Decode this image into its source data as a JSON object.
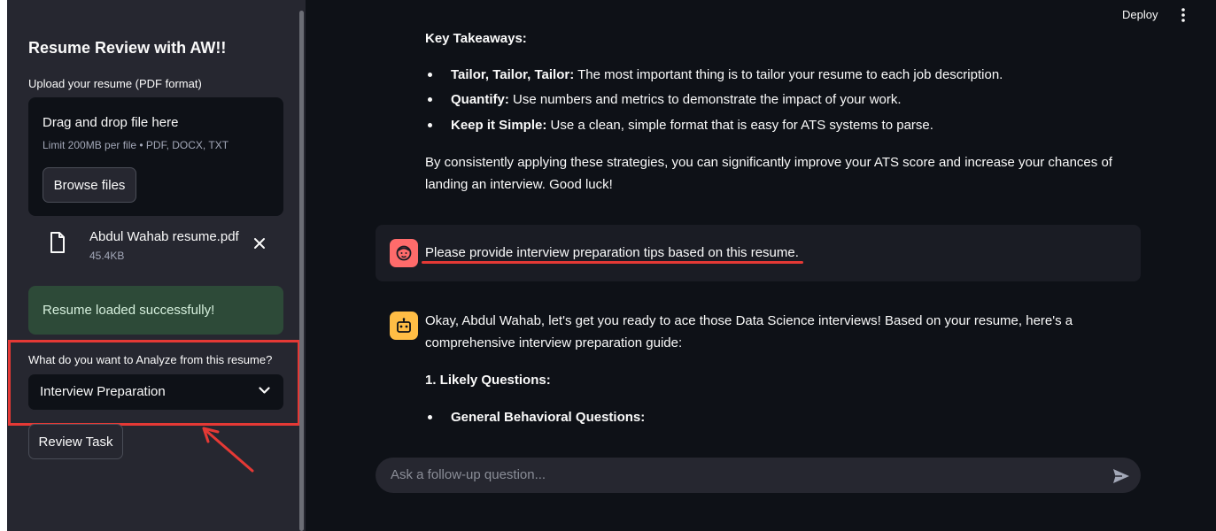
{
  "sidebar": {
    "title": "Resume Review with AW!!",
    "upload_label": "Upload your resume (PDF format)",
    "dropzone": {
      "title": "Drag and drop file here",
      "limit": "Limit 200MB per file • PDF, DOCX, TXT",
      "browse_label": "Browse files"
    },
    "file": {
      "name": "Abdul Wahab resume.pdf",
      "size": "45.4KB",
      "icon": "file-icon"
    },
    "success_message": "Resume loaded successfully!",
    "analyze_label": "What do you want to Analyze from this resume?",
    "analyze_selected": "Interview Preparation",
    "review_button": "Review Task"
  },
  "header": {
    "deploy_label": "Deploy"
  },
  "chat": {
    "prev_response": {
      "heading": "Key Takeaways:",
      "bullets": [
        {
          "bold": "Tailor, Tailor, Tailor:",
          "text": " The most important thing is to tailor your resume to each job description."
        },
        {
          "bold": "Quantify:",
          "text": " Use numbers and metrics to demonstrate the impact of your work."
        },
        {
          "bold": "Keep it Simple:",
          "text": " Use a clean, simple format that is easy for ATS systems to parse."
        }
      ],
      "closing_line1": "By consistently applying these strategies, you can significantly improve your ATS score and increase your chances of",
      "closing_line2": "landing an interview. Good luck!"
    },
    "user_message": "Please provide interview preparation tips based on this resume.",
    "assistant": {
      "line1": "Okay, Abdul Wahab, let's get you ready to ace those Data Science interviews! Based on your resume, here's a",
      "line2": "comprehensive interview preparation guide:",
      "section1": "1. Likely Questions:",
      "bullet1": "General Behavioral Questions:"
    },
    "input_placeholder": "Ask a follow-up question..."
  },
  "colors": {
    "sidebar_bg": "#262730",
    "main_bg": "#0e1117",
    "success_bg": "#2d4a38",
    "annotation_red": "#e53935",
    "user_avatar": "#ff6b6b",
    "assistant_avatar": "#ffbd45"
  }
}
